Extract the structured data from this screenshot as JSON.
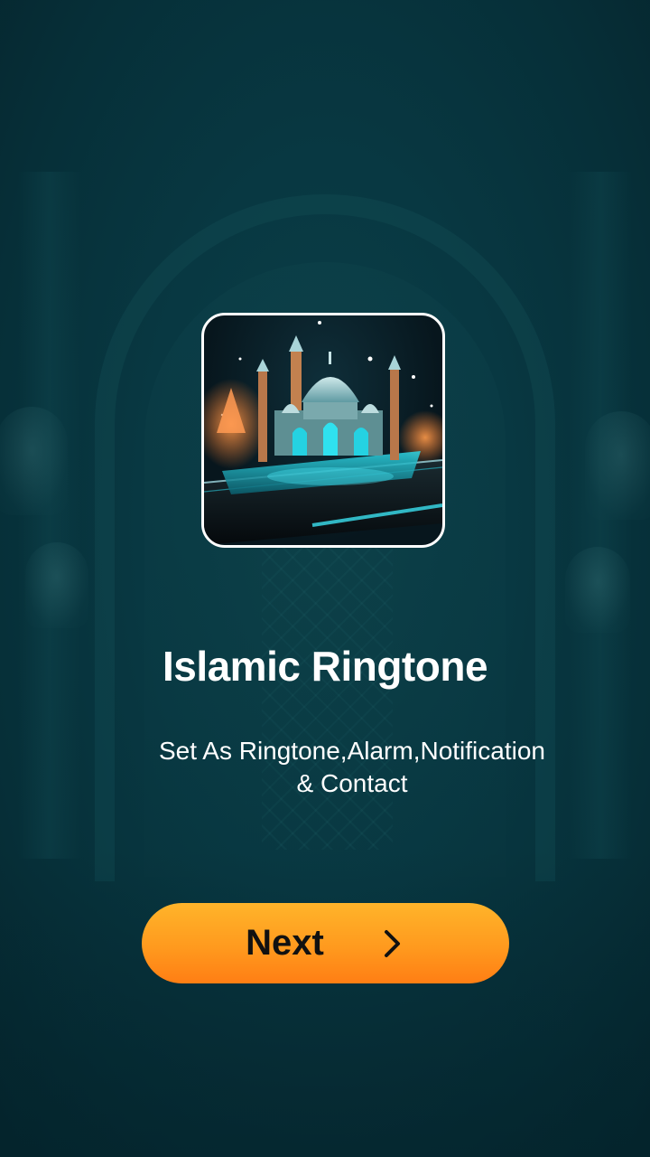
{
  "app": {
    "icon_name": "mosque-app-icon"
  },
  "onboarding": {
    "title": "Islamic Ringtone",
    "subtitle_line1": "Set As Ringtone,Alarm,Notification",
    "subtitle_line2": "& Contact"
  },
  "actions": {
    "next_label": "Next",
    "next_icon": "chevron-right-icon"
  },
  "colors": {
    "background": "#083842",
    "button_top": "#ffb42a",
    "button_bottom": "#ff7e14",
    "text": "#ffffff",
    "button_text": "#111111"
  }
}
